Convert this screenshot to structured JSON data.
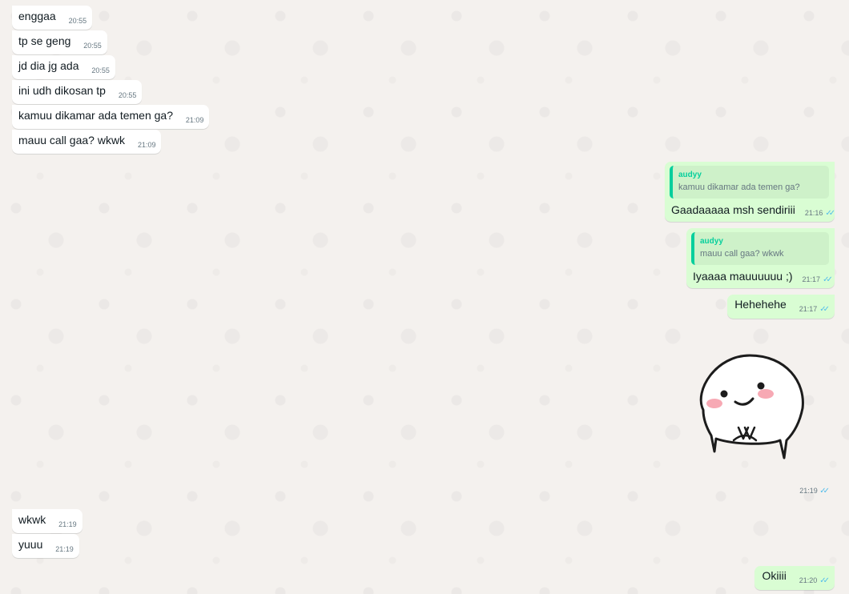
{
  "incoming_top": [
    {
      "text": "enggaa",
      "time": "20:55"
    },
    {
      "text": "tp se geng",
      "time": "20:55"
    },
    {
      "text": "jd dia jg ada",
      "time": "20:55"
    },
    {
      "text": "ini udh dikosan tp",
      "time": "20:55"
    },
    {
      "text": "kamuu dikamar ada temen ga?",
      "time": "21:09"
    },
    {
      "text": "mauu call gaa? wkwk",
      "time": "21:09"
    }
  ],
  "replies": [
    {
      "author": "audyy",
      "quote": "kamuu dikamar ada temen ga?",
      "text": "Gaadaaaaa msh sendiriii",
      "time": "21:16"
    },
    {
      "author": "audyy",
      "quote": "mauu call gaa? wkwk",
      "text": "Iyaaaa mauuuuuu ;)",
      "time": "21:17"
    }
  ],
  "outgoing_plain": {
    "text": "Hehehehe",
    "time": "21:17"
  },
  "sticker": {
    "time": "21:19",
    "icon": "smiling-mochi-sticker"
  },
  "incoming_bottom": [
    {
      "text": "wkwk",
      "time": "21:19"
    },
    {
      "text": "yuuu",
      "time": "21:19"
    }
  ],
  "outgoing_last": {
    "text": "Okiiii",
    "time": "21:20"
  },
  "read_tick": "✓✓",
  "colors": {
    "outgoing_bubble": "#d9fdd3",
    "incoming_bubble": "#ffffff",
    "quote_accent": "#06cf9c",
    "read_tick": "#53bdeb"
  }
}
